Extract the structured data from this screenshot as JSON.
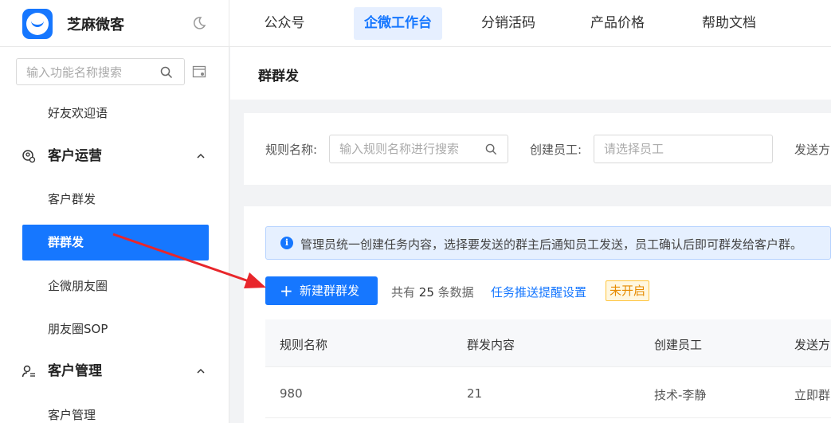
{
  "app": {
    "name": "芝麻微客",
    "brand_color": "#1677ff"
  },
  "topnav": {
    "items": [
      {
        "label": "公众号",
        "active": false
      },
      {
        "label": "企微工作台",
        "active": true
      },
      {
        "label": "分销活码",
        "active": false
      },
      {
        "label": "产品价格",
        "active": false
      },
      {
        "label": "帮助文档",
        "active": false
      }
    ]
  },
  "sidebar": {
    "search_placeholder": "输入功能名称搜索",
    "items": [
      {
        "type": "item",
        "label": "好友欢迎语"
      },
      {
        "type": "group",
        "label": "客户运营",
        "icon": "customer-ops-icon",
        "expanded": true
      },
      {
        "type": "item",
        "label": "客户群发"
      },
      {
        "type": "item",
        "label": "群群发",
        "active": true
      },
      {
        "type": "item",
        "label": "企微朋友圈"
      },
      {
        "type": "item",
        "label": "朋友圈SOP"
      },
      {
        "type": "group",
        "label": "客户管理",
        "icon": "customer-manage-icon",
        "expanded": true
      },
      {
        "type": "item",
        "label": "客户管理"
      }
    ]
  },
  "page": {
    "title": "群群发"
  },
  "filters": {
    "rule_name_label": "规则名称:",
    "rule_name_placeholder": "输入规则名称进行搜索",
    "creator_label": "创建员工:",
    "creator_placeholder": "请选择员工",
    "send_label": "发送方"
  },
  "list": {
    "notice": "管理员统一创建任务内容，选择要发送的群主后通知员工发送，员工确认后即可群发给客户群。",
    "new_button_label": "新建群群发",
    "total_prefix": "共有",
    "total_count": "25",
    "total_suffix": "条数据",
    "reminder_link": "任务推送提醒设置",
    "reminder_status": "未开启",
    "columns": [
      "规则名称",
      "群发内容",
      "创建员工",
      "发送方"
    ],
    "rows": [
      [
        "980",
        "21",
        "技术-李静",
        "立即群"
      ]
    ]
  }
}
